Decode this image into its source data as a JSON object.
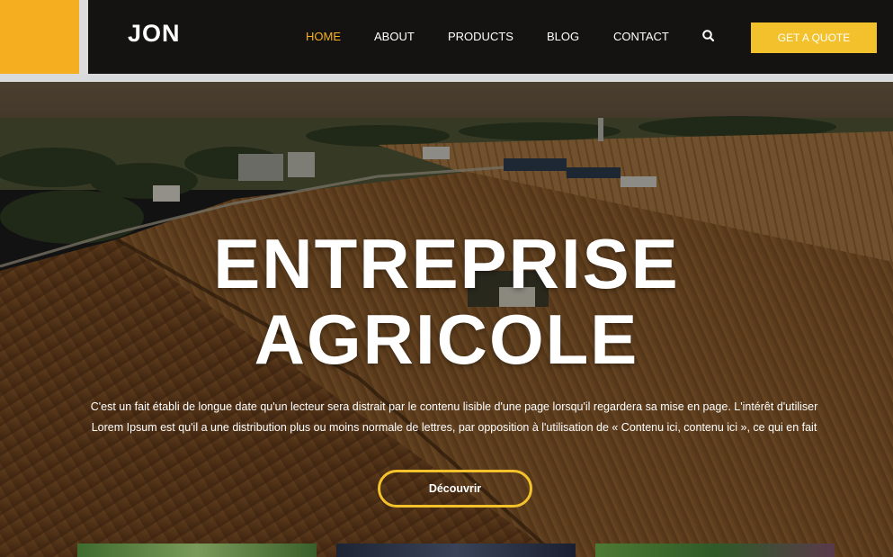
{
  "brand": {
    "logo": "JON"
  },
  "nav": {
    "items": [
      {
        "label": "HOME",
        "active": true
      },
      {
        "label": "ABOUT",
        "active": false
      },
      {
        "label": "PRODUCTS",
        "active": false
      },
      {
        "label": "BLOG",
        "active": false
      },
      {
        "label": "CONTACT",
        "active": false
      }
    ],
    "search_icon": "search-icon",
    "cta_label": "GET A QUOTE"
  },
  "hero": {
    "title_line1": "ENTREPRISE",
    "title_line2": "AGRICOLE",
    "paragraph_line1": "C'est un fait établi de longue date qu'un lecteur sera distrait par le contenu lisible d'une page lorsqu'il regardera sa mise en page. L'intérêt d'utiliser",
    "paragraph_line2": "Lorem Ipsum est qu'il a une distribution plus ou moins normale de lettres, par opposition à l'utilisation de « Contenu ici, contenu ici », ce qui en fait",
    "button_label": "Découvrir"
  },
  "colors": {
    "accent_orange": "#f5ae1f",
    "accent_yellow": "#f2c12b",
    "header_bg": "#151312",
    "active_nav": "#f5b11e"
  }
}
